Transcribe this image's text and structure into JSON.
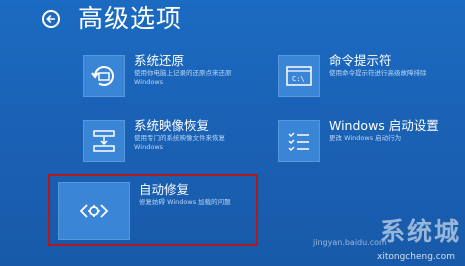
{
  "header": {
    "title": "高级选项"
  },
  "options": [
    {
      "title": "系统还原",
      "desc": [
        "使用你电脑上记录的还原点来还原",
        "Windows"
      ],
      "icon": "system-restore-icon"
    },
    {
      "title": "命令提示符",
      "desc": [
        "使用命令提示符进行高级故障排除"
      ],
      "icon": "command-prompt-icon"
    },
    {
      "title": "系统映像恢复",
      "desc": [
        "使用专门的系统映像文件来恢复",
        "Windows"
      ],
      "icon": "system-image-icon"
    },
    {
      "title": "Windows 启动设置",
      "desc": [
        "更改 Windows 启动行为"
      ],
      "icon": "startup-settings-icon"
    },
    {
      "title": "自动修复",
      "desc": [
        "修复妨碍 Windows 加载的问题"
      ],
      "icon": "automatic-repair-icon"
    }
  ],
  "watermark": {
    "brand": "系统城",
    "sub": "jingyan.baidu.com",
    "url": "xitongcheng.com"
  },
  "colors": {
    "background": "#1a63b8",
    "tile": "#3a85d6",
    "highlight": "#b3181c"
  }
}
